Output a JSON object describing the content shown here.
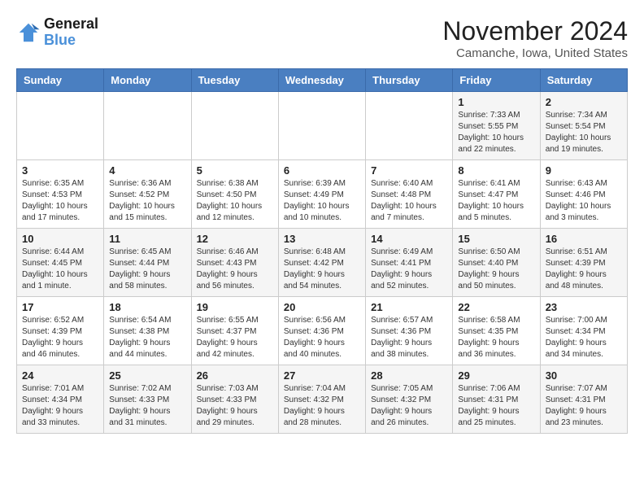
{
  "logo": {
    "line1": "General",
    "line2": "Blue"
  },
  "title": "November 2024",
  "location": "Camanche, Iowa, United States",
  "days_of_week": [
    "Sunday",
    "Monday",
    "Tuesday",
    "Wednesday",
    "Thursday",
    "Friday",
    "Saturday"
  ],
  "weeks": [
    [
      {
        "day": "",
        "info": ""
      },
      {
        "day": "",
        "info": ""
      },
      {
        "day": "",
        "info": ""
      },
      {
        "day": "",
        "info": ""
      },
      {
        "day": "",
        "info": ""
      },
      {
        "day": "1",
        "info": "Sunrise: 7:33 AM\nSunset: 5:55 PM\nDaylight: 10 hours and 22 minutes."
      },
      {
        "day": "2",
        "info": "Sunrise: 7:34 AM\nSunset: 5:54 PM\nDaylight: 10 hours and 19 minutes."
      }
    ],
    [
      {
        "day": "3",
        "info": "Sunrise: 6:35 AM\nSunset: 4:53 PM\nDaylight: 10 hours and 17 minutes."
      },
      {
        "day": "4",
        "info": "Sunrise: 6:36 AM\nSunset: 4:52 PM\nDaylight: 10 hours and 15 minutes."
      },
      {
        "day": "5",
        "info": "Sunrise: 6:38 AM\nSunset: 4:50 PM\nDaylight: 10 hours and 12 minutes."
      },
      {
        "day": "6",
        "info": "Sunrise: 6:39 AM\nSunset: 4:49 PM\nDaylight: 10 hours and 10 minutes."
      },
      {
        "day": "7",
        "info": "Sunrise: 6:40 AM\nSunset: 4:48 PM\nDaylight: 10 hours and 7 minutes."
      },
      {
        "day": "8",
        "info": "Sunrise: 6:41 AM\nSunset: 4:47 PM\nDaylight: 10 hours and 5 minutes."
      },
      {
        "day": "9",
        "info": "Sunrise: 6:43 AM\nSunset: 4:46 PM\nDaylight: 10 hours and 3 minutes."
      }
    ],
    [
      {
        "day": "10",
        "info": "Sunrise: 6:44 AM\nSunset: 4:45 PM\nDaylight: 10 hours and 1 minute."
      },
      {
        "day": "11",
        "info": "Sunrise: 6:45 AM\nSunset: 4:44 PM\nDaylight: 9 hours and 58 minutes."
      },
      {
        "day": "12",
        "info": "Sunrise: 6:46 AM\nSunset: 4:43 PM\nDaylight: 9 hours and 56 minutes."
      },
      {
        "day": "13",
        "info": "Sunrise: 6:48 AM\nSunset: 4:42 PM\nDaylight: 9 hours and 54 minutes."
      },
      {
        "day": "14",
        "info": "Sunrise: 6:49 AM\nSunset: 4:41 PM\nDaylight: 9 hours and 52 minutes."
      },
      {
        "day": "15",
        "info": "Sunrise: 6:50 AM\nSunset: 4:40 PM\nDaylight: 9 hours and 50 minutes."
      },
      {
        "day": "16",
        "info": "Sunrise: 6:51 AM\nSunset: 4:39 PM\nDaylight: 9 hours and 48 minutes."
      }
    ],
    [
      {
        "day": "17",
        "info": "Sunrise: 6:52 AM\nSunset: 4:39 PM\nDaylight: 9 hours and 46 minutes."
      },
      {
        "day": "18",
        "info": "Sunrise: 6:54 AM\nSunset: 4:38 PM\nDaylight: 9 hours and 44 minutes."
      },
      {
        "day": "19",
        "info": "Sunrise: 6:55 AM\nSunset: 4:37 PM\nDaylight: 9 hours and 42 minutes."
      },
      {
        "day": "20",
        "info": "Sunrise: 6:56 AM\nSunset: 4:36 PM\nDaylight: 9 hours and 40 minutes."
      },
      {
        "day": "21",
        "info": "Sunrise: 6:57 AM\nSunset: 4:36 PM\nDaylight: 9 hours and 38 minutes."
      },
      {
        "day": "22",
        "info": "Sunrise: 6:58 AM\nSunset: 4:35 PM\nDaylight: 9 hours and 36 minutes."
      },
      {
        "day": "23",
        "info": "Sunrise: 7:00 AM\nSunset: 4:34 PM\nDaylight: 9 hours and 34 minutes."
      }
    ],
    [
      {
        "day": "24",
        "info": "Sunrise: 7:01 AM\nSunset: 4:34 PM\nDaylight: 9 hours and 33 minutes."
      },
      {
        "day": "25",
        "info": "Sunrise: 7:02 AM\nSunset: 4:33 PM\nDaylight: 9 hours and 31 minutes."
      },
      {
        "day": "26",
        "info": "Sunrise: 7:03 AM\nSunset: 4:33 PM\nDaylight: 9 hours and 29 minutes."
      },
      {
        "day": "27",
        "info": "Sunrise: 7:04 AM\nSunset: 4:32 PM\nDaylight: 9 hours and 28 minutes."
      },
      {
        "day": "28",
        "info": "Sunrise: 7:05 AM\nSunset: 4:32 PM\nDaylight: 9 hours and 26 minutes."
      },
      {
        "day": "29",
        "info": "Sunrise: 7:06 AM\nSunset: 4:31 PM\nDaylight: 9 hours and 25 minutes."
      },
      {
        "day": "30",
        "info": "Sunrise: 7:07 AM\nSunset: 4:31 PM\nDaylight: 9 hours and 23 minutes."
      }
    ]
  ]
}
